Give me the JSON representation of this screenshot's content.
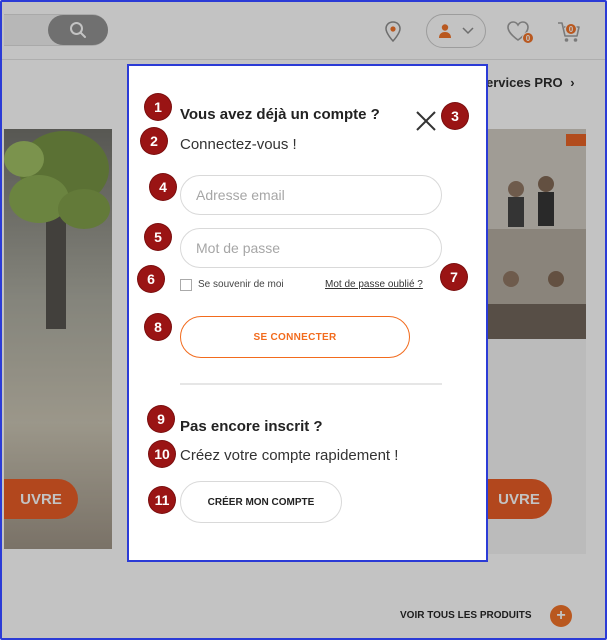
{
  "header": {
    "search_icon": "search-icon",
    "store_icon": "location-pin-icon",
    "account_icon": "user-icon",
    "wishlist_count": "0",
    "cart_count": "0"
  },
  "background": {
    "services_link": "ervices PRO",
    "promo_left_button": "UVRE",
    "promo_right_button": "UVRE",
    "see_all_products": "VOIR TOUS LES PRODUITS",
    "plus_label": "+"
  },
  "modal": {
    "title": "Vous avez déjà un compte ?",
    "subtitle": "Connectez-vous !",
    "email_placeholder": "Adresse email",
    "password_placeholder": "Mot de passe",
    "remember_me": "Se souvenir de moi",
    "forgot_password": "Mot de passe oublié ?",
    "login_button": "SE CONNECTER",
    "signup_title": "Pas encore inscrit ?",
    "signup_subtitle": "Créez votre compte rapidement !",
    "create_button": "CRÉER MON COMPTE"
  },
  "callouts": [
    "1",
    "2",
    "3",
    "4",
    "5",
    "6",
    "7",
    "8",
    "9",
    "10",
    "11"
  ],
  "colors": {
    "accent": "#f26b1d",
    "callout": "#9a1414",
    "frame": "#2b3bd6"
  }
}
